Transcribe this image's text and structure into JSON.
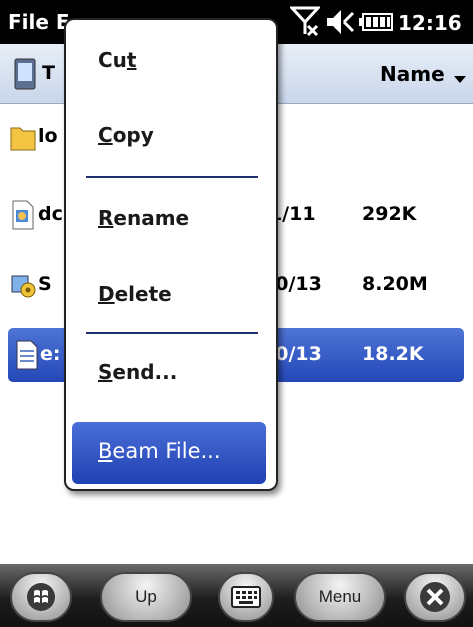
{
  "titlebar": {
    "app_title": "File E",
    "clock": "12:16"
  },
  "pathbar": {
    "path": "T",
    "sort_label": "Name"
  },
  "files": [
    {
      "name": "lo",
      "date": "",
      "size": "",
      "icon": "folder-icon",
      "selected": false
    },
    {
      "name": "dc",
      "date": "/1/11",
      "size": "292K",
      "icon": "document-icon",
      "selected": false
    },
    {
      "name": "S",
      "date": "20/13",
      "size": "8.20M",
      "icon": "setup-package-icon",
      "selected": false
    },
    {
      "name": "e:",
      "date": "20/13",
      "size": "18.2K",
      "icon": "text-file-icon",
      "selected": true
    }
  ],
  "context_menu": {
    "cut_pre": "Cu",
    "cut_u": "t",
    "cut_post": "",
    "copy_pre": "",
    "copy_u": "C",
    "copy_post": "opy",
    "rename_pre": "",
    "rename_u": "R",
    "rename_post": "ename",
    "delete_pre": "",
    "delete_u": "D",
    "delete_post": "elete",
    "send_pre": "",
    "send_u": "S",
    "send_post": "end...",
    "beam_pre": "",
    "beam_u": "B",
    "beam_post": "eam File..."
  },
  "softkeys": {
    "up_label": "Up",
    "menu_label": "Menu"
  },
  "colors": {
    "selection": "#2448b8",
    "menu_separator": "#1e2f6b"
  }
}
